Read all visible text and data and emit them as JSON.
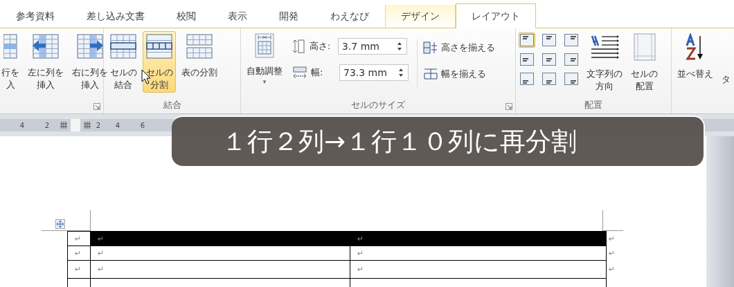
{
  "tabs": [
    {
      "label": "参考資料",
      "kind": "normal",
      "selected": false
    },
    {
      "label": "差し込み文書",
      "kind": "normal",
      "selected": false
    },
    {
      "label": "校閲",
      "kind": "normal",
      "selected": false
    },
    {
      "label": "表示",
      "kind": "normal",
      "selected": false
    },
    {
      "label": "開発",
      "kind": "normal",
      "selected": false
    },
    {
      "label": "わえなび",
      "kind": "normal",
      "selected": false
    },
    {
      "label": "デザイン",
      "kind": "contextual",
      "selected": false
    },
    {
      "label": "レイアウト",
      "kind": "contextual",
      "selected": true
    }
  ],
  "ribbon": {
    "groups": [
      {
        "launcher": true,
        "buttons": [
          {
            "lines": [
              "行を",
              "入"
            ],
            "hover": false
          },
          {
            "lines": [
              "左に列を",
              "挿入"
            ],
            "hover": false
          },
          {
            "lines": [
              "右に列を",
              "挿入"
            ],
            "hover": false
          }
        ]
      },
      {
        "label": "結合",
        "buttons": [
          {
            "lines": [
              "セルの",
              "結合"
            ],
            "hover": false
          },
          {
            "lines": [
              "セルの",
              "分割"
            ],
            "hover": true
          },
          {
            "lines": [
              "表の分割"
            ],
            "hover": false
          }
        ]
      },
      {
        "label": "セルのサイズ",
        "launcher": true,
        "autofit": {
          "label": "自動調整",
          "dropdown": "▾"
        },
        "fields": [
          {
            "kind": "height",
            "label": "高さ:",
            "value": "3.7 mm"
          },
          {
            "kind": "width",
            "label": "幅:",
            "value": "73.3 mm"
          }
        ],
        "distribute": [
          {
            "kind": "rows",
            "label": "高さを揃える"
          },
          {
            "kind": "cols",
            "label": "幅を揃える"
          }
        ]
      },
      {
        "label": "配置",
        "align_buttons": [
          {
            "selected": true
          },
          {
            "selected": false
          },
          {
            "selected": false
          },
          {
            "selected": false
          },
          {
            "selected": false
          },
          {
            "selected": false
          },
          {
            "selected": false
          },
          {
            "selected": false
          },
          {
            "selected": false
          }
        ],
        "buttons": [
          {
            "lines": [
              "文字列の",
              "方向"
            ],
            "hover": false
          },
          {
            "lines": [
              "セルの",
              "配置"
            ],
            "hover": false
          }
        ]
      },
      {
        "buttons": [
          {
            "lines": [
              "並べ替え"
            ],
            "hover": false
          },
          {
            "lines": [
              "タ"
            ],
            "hover": false
          }
        ]
      }
    ]
  },
  "ruler": {
    "labels": [
      "4",
      "2",
      "2",
      "4",
      "6"
    ]
  },
  "caption": "１行２列→１行１０列に再分割",
  "table": {
    "rows": [
      {
        "cells": [
          {
            "text": "↵",
            "selected": false
          },
          {
            "text": "↵",
            "selected": true
          },
          {
            "text": "↵",
            "selected": true
          }
        ],
        "end_mark": "↵"
      },
      {
        "cells": [
          {
            "text": "↵",
            "selected": false
          },
          {
            "text": "↵",
            "selected": false
          },
          {
            "text": "↵",
            "selected": false
          }
        ],
        "end_mark": "↵"
      },
      {
        "cells": [
          {
            "text": "↵",
            "selected": false
          },
          {
            "text": "↵",
            "selected": false
          },
          {
            "text": "↵",
            "selected": false
          }
        ],
        "end_mark": "↵"
      }
    ]
  }
}
